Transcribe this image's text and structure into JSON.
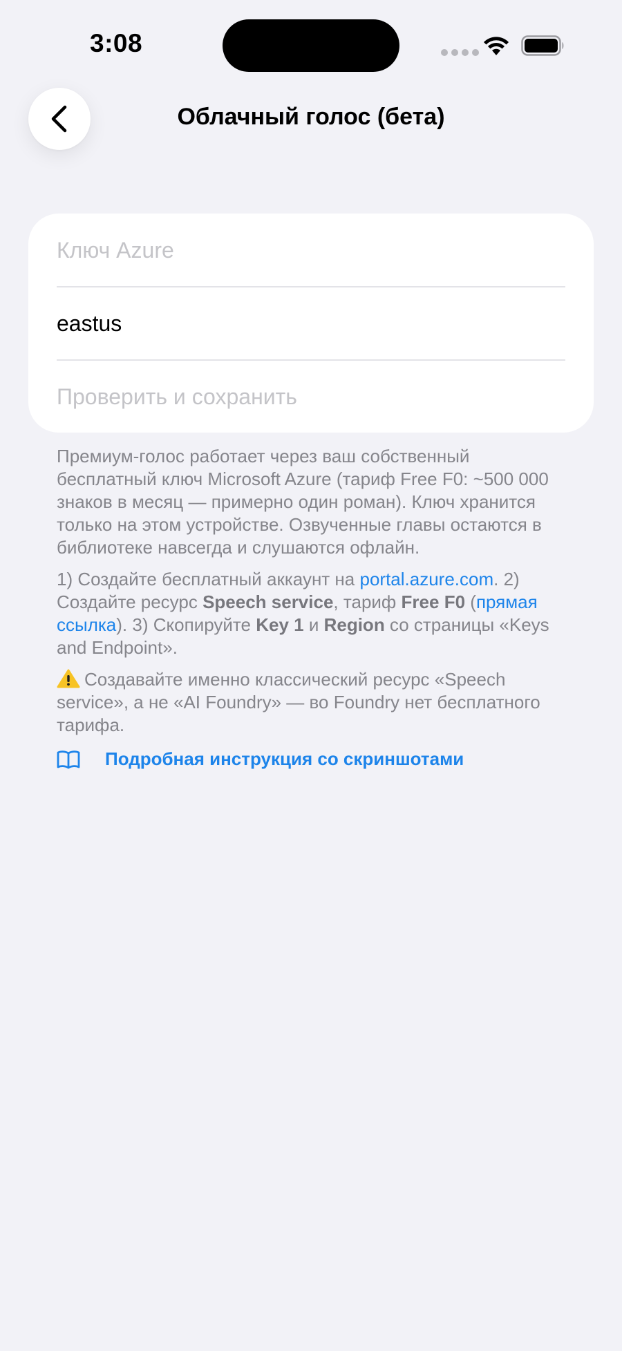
{
  "status_bar": {
    "time": "3:08"
  },
  "nav": {
    "title": "Облачный голос (бета)"
  },
  "form": {
    "key_placeholder": "Ключ Azure",
    "region_value": "eastus",
    "verify_label": "Проверить и сохранить"
  },
  "info": {
    "paragraph1": "Премиум-голос работает через ваш собственный бесплатный ключ Microsoft Azure (тариф Free F0: ~500 000 знаков в месяц — примерно один роман). Ключ хранится только на этом устройстве. Озвученные главы остаются в библиотеке навсегда и слушаются офлайн.",
    "steps": {
      "s1_prefix": "1) Создайте бесплатный аккаунт на ",
      "s1_link": "portal.azure.com",
      "s2_prefix": ". 2) Создайте ресурс ",
      "s2_bold1": "Speech service",
      "s2_mid": ", тариф ",
      "s2_bold2": "Free F0",
      "s2_open": " (",
      "s2_link": "прямая ссылка",
      "s3_prefix": "). 3) Скопируйте ",
      "s3_bold1": "Key 1",
      "s3_mid": " и ",
      "s3_bold2": "Region",
      "s3_suffix": " со страницы «Keys and Endpoint»."
    },
    "warning": "Создавайте именно классический ресурс «Speech service», а не «AI Foundry» — во Foundry нет бесплатного тарифа.",
    "guide_link": "Подробная инструкция со скриншотами"
  },
  "colors": {
    "background": "#f2f2f7",
    "accent": "#1d84ea",
    "secondary_text": "#85858b",
    "placeholder": "#c4c4c8"
  },
  "icons": [
    "chevron-left-icon",
    "wifi-icon",
    "battery-icon",
    "warning-icon",
    "book-icon"
  ]
}
